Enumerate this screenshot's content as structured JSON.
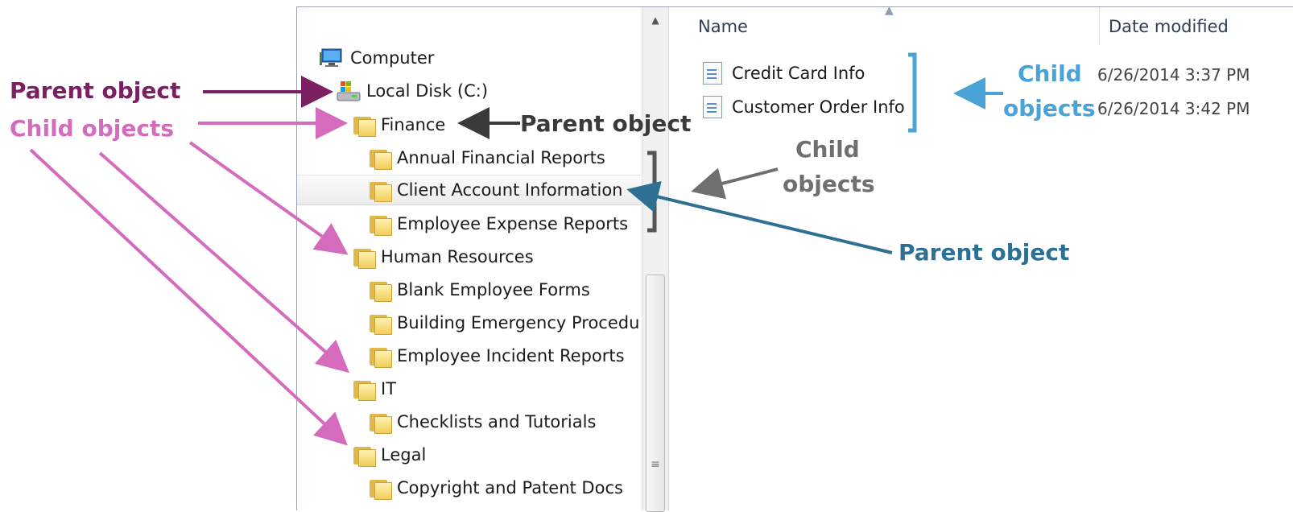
{
  "nav": {
    "items": [
      {
        "label": "Computer",
        "icon": "computer-icon"
      },
      {
        "label": "Local Disk (C:)",
        "icon": "local-disk-icon"
      },
      {
        "label": "Finance",
        "icon": "folder-icon"
      },
      {
        "label": "Annual Financial Reports",
        "icon": "folder-icon"
      },
      {
        "label": "Client Account Information",
        "icon": "folder-icon"
      },
      {
        "label": "Employee Expense Reports",
        "icon": "folder-icon"
      },
      {
        "label": "Human Resources",
        "icon": "folder-icon"
      },
      {
        "label": "Blank Employee Forms",
        "icon": "folder-icon"
      },
      {
        "label": "Building Emergency Procedu",
        "icon": "folder-icon"
      },
      {
        "label": "Employee Incident Reports",
        "icon": "folder-icon"
      },
      {
        "label": "IT",
        "icon": "folder-icon"
      },
      {
        "label": "Checklists and Tutorials",
        "icon": "folder-icon"
      },
      {
        "label": "Legal",
        "icon": "folder-icon"
      },
      {
        "label": "Copyright and Patent Docs",
        "icon": "folder-icon"
      }
    ]
  },
  "content": {
    "columns": {
      "name": "Name",
      "date": "Date modified"
    },
    "files": [
      {
        "name": "Credit Card Info",
        "date": "6/26/2014 3:37 PM",
        "icon": "document-icon"
      },
      {
        "name": "Customer Order Info",
        "date": "6/26/2014 3:42 PM",
        "icon": "document-icon"
      }
    ]
  },
  "annotations": {
    "left_parent": "Parent object",
    "left_child": "Child objects",
    "finance_parent": "Parent object",
    "grey_child_1": "Child",
    "grey_child_2": "objects",
    "blue_child_1": "Child",
    "blue_child_2": "objects",
    "teal_parent": "Parent object"
  },
  "colors": {
    "purple": "#7b1f63",
    "pink": "#d46bbd",
    "dark_grey": "#3a3a3a",
    "grey": "#6f6f6f",
    "light_blue": "#4aa3d6",
    "teal": "#2e6f94"
  }
}
